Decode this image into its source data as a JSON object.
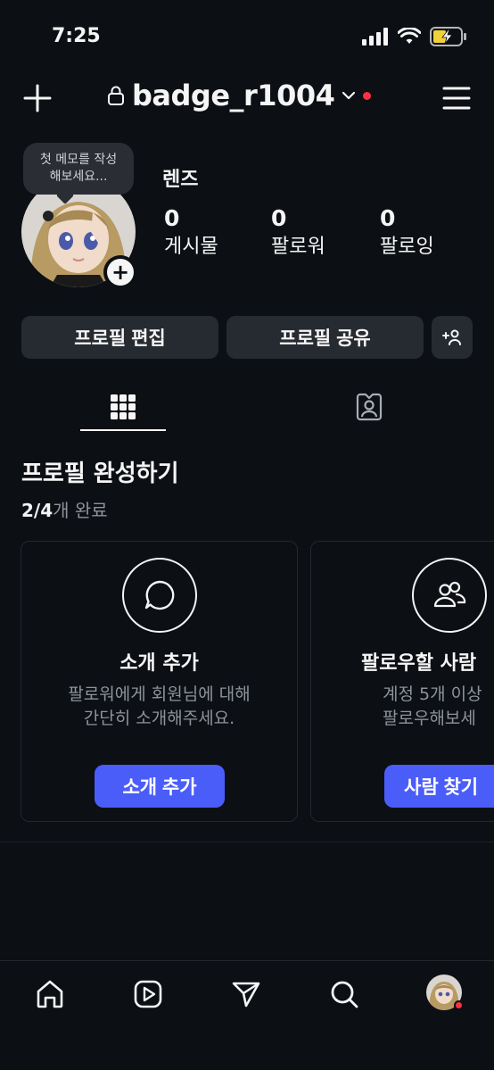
{
  "status_bar": {
    "time": "7:25"
  },
  "header": {
    "username": "badge_r1004"
  },
  "profile": {
    "memo_line1": "첫 메모를 작성",
    "memo_line2": "해보세요...",
    "nickname": "렌즈",
    "stats": [
      {
        "value": "0",
        "label": "게시물"
      },
      {
        "value": "0",
        "label": "팔로워"
      },
      {
        "value": "0",
        "label": "팔로잉"
      }
    ]
  },
  "buttons": {
    "edit_profile": "프로필 편집",
    "share_profile": "프로필 공유"
  },
  "completion": {
    "title": "프로필 완성하기",
    "progress_bold": "2/4",
    "progress_rest": "개 완료",
    "progress_fraction": 0.5,
    "cards": [
      {
        "title": "소개 추가",
        "desc_line1": "팔로워에게 회원님에 대해",
        "desc_line2": "간단히 소개해주세요.",
        "button": "소개 추가",
        "icon": "speech-bubble-icon"
      },
      {
        "title": "팔로우할 사람",
        "desc_line1": "계정 5개 이상",
        "desc_line2": "팔로우해보세",
        "button": "사람 찾기",
        "icon": "people-icon"
      }
    ]
  },
  "nav": [
    "home-icon",
    "reels-icon",
    "send-icon",
    "search-icon",
    "profile-avatar"
  ],
  "colors": {
    "background": "#0c0f14",
    "accent": "#4a5df9",
    "notification": "#ff3040",
    "button_bg": "#262a31"
  }
}
